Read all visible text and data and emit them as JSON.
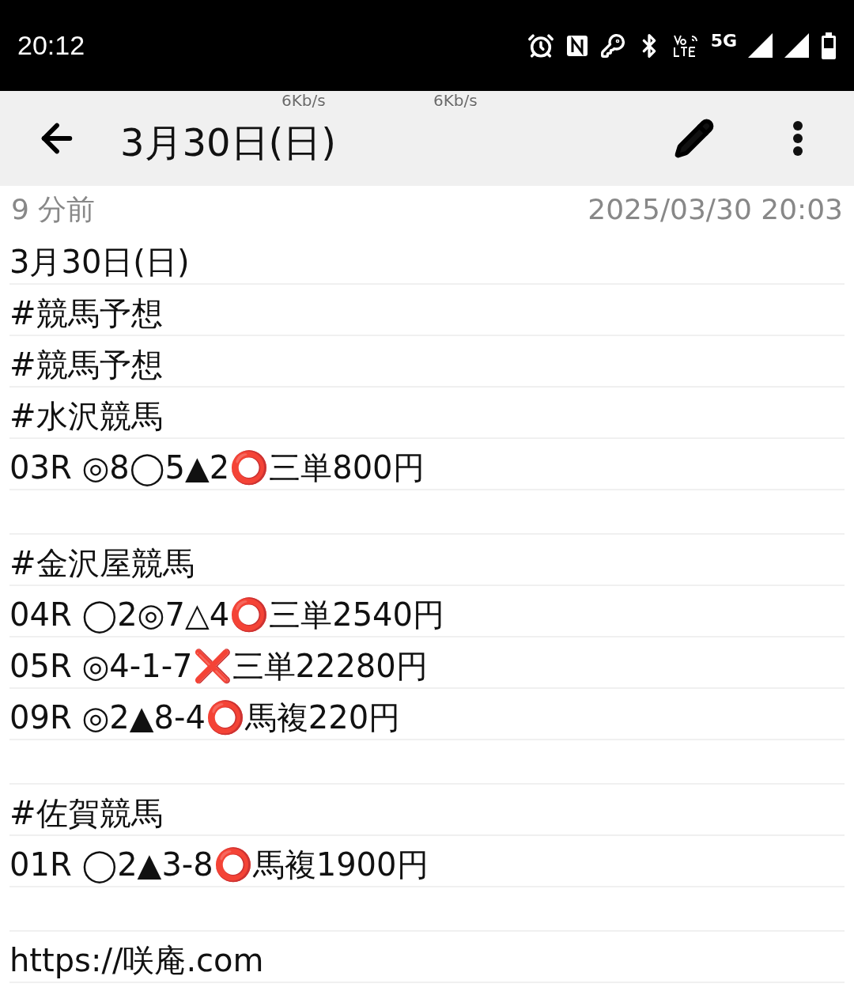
{
  "status_bar": {
    "time": "20:12",
    "network": "5G"
  },
  "speed_overlays": [
    "6Kb/s",
    "6Kb/s"
  ],
  "toolbar": {
    "title": "3月30日(日)"
  },
  "meta": {
    "relative_time": "9 分前",
    "timestamp": "2025/03/30 20:03"
  },
  "lines": [
    {
      "kind": "text",
      "text": "3月30日(日)"
    },
    {
      "kind": "text",
      "text": "#競馬予想"
    },
    {
      "kind": "text",
      "text": "#競馬予想"
    },
    {
      "kind": "text",
      "text": "#水沢競馬"
    },
    {
      "kind": "text",
      "text": "03R ◎8◯5▲2⭕三単800円"
    },
    {
      "kind": "blank"
    },
    {
      "kind": "text",
      "text": "#金沢屋競馬"
    },
    {
      "kind": "text",
      "text": "04R ◯2◎7△4⭕三単2540円"
    },
    {
      "kind": "text",
      "text": "05R ◎4-1-7❌三単22280円"
    },
    {
      "kind": "text",
      "text": "09R ◎2▲8-4⭕馬複220円"
    },
    {
      "kind": "blank"
    },
    {
      "kind": "text",
      "text": "#佐賀競馬"
    },
    {
      "kind": "text",
      "text": "01R ◯2▲3-8⭕馬複1900円"
    },
    {
      "kind": "blank"
    },
    {
      "kind": "text",
      "text": "https://咲庵.com"
    }
  ]
}
